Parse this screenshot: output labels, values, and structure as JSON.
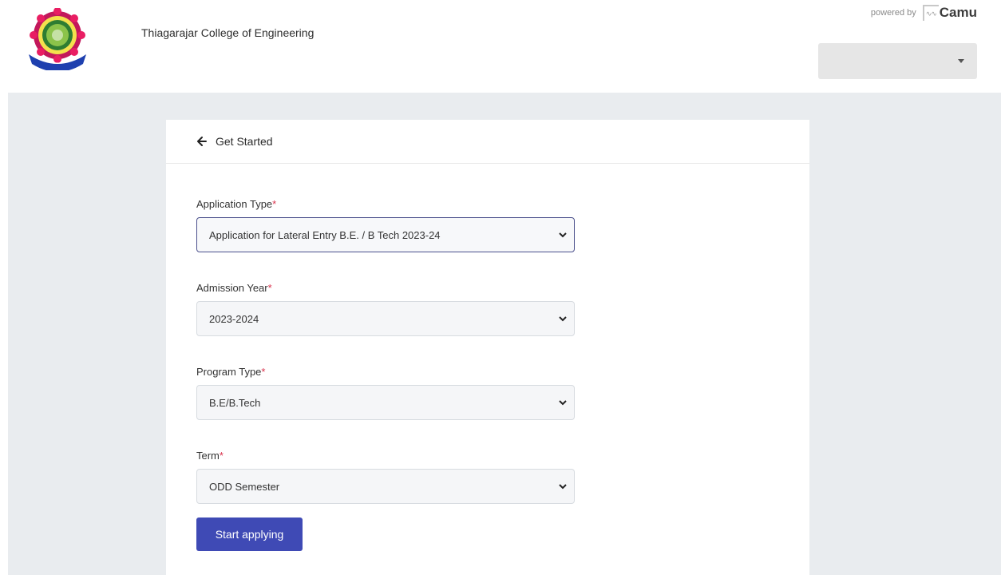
{
  "header": {
    "college_name": "Thiagarajar College of Engineering",
    "powered_by": "powered by",
    "camu_brand": "Camu",
    "language_select_value": ""
  },
  "card": {
    "title": "Get Started",
    "fields": [
      {
        "label": "Application Type",
        "required_mark": "*",
        "value": "Application for Lateral Entry B.E. / B Tech 2023-24"
      },
      {
        "label": "Admission Year",
        "required_mark": "*",
        "value": "2023-2024"
      },
      {
        "label": "Program Type",
        "required_mark": "*",
        "value": "B.E/B.Tech"
      },
      {
        "label": "Term",
        "required_mark": "*",
        "value": "ODD Semester"
      }
    ],
    "submit_label": "Start applying"
  },
  "colors": {
    "primary_button": "#3f4ab5",
    "required": "#d9334d",
    "page_background": "#e9ecef"
  }
}
